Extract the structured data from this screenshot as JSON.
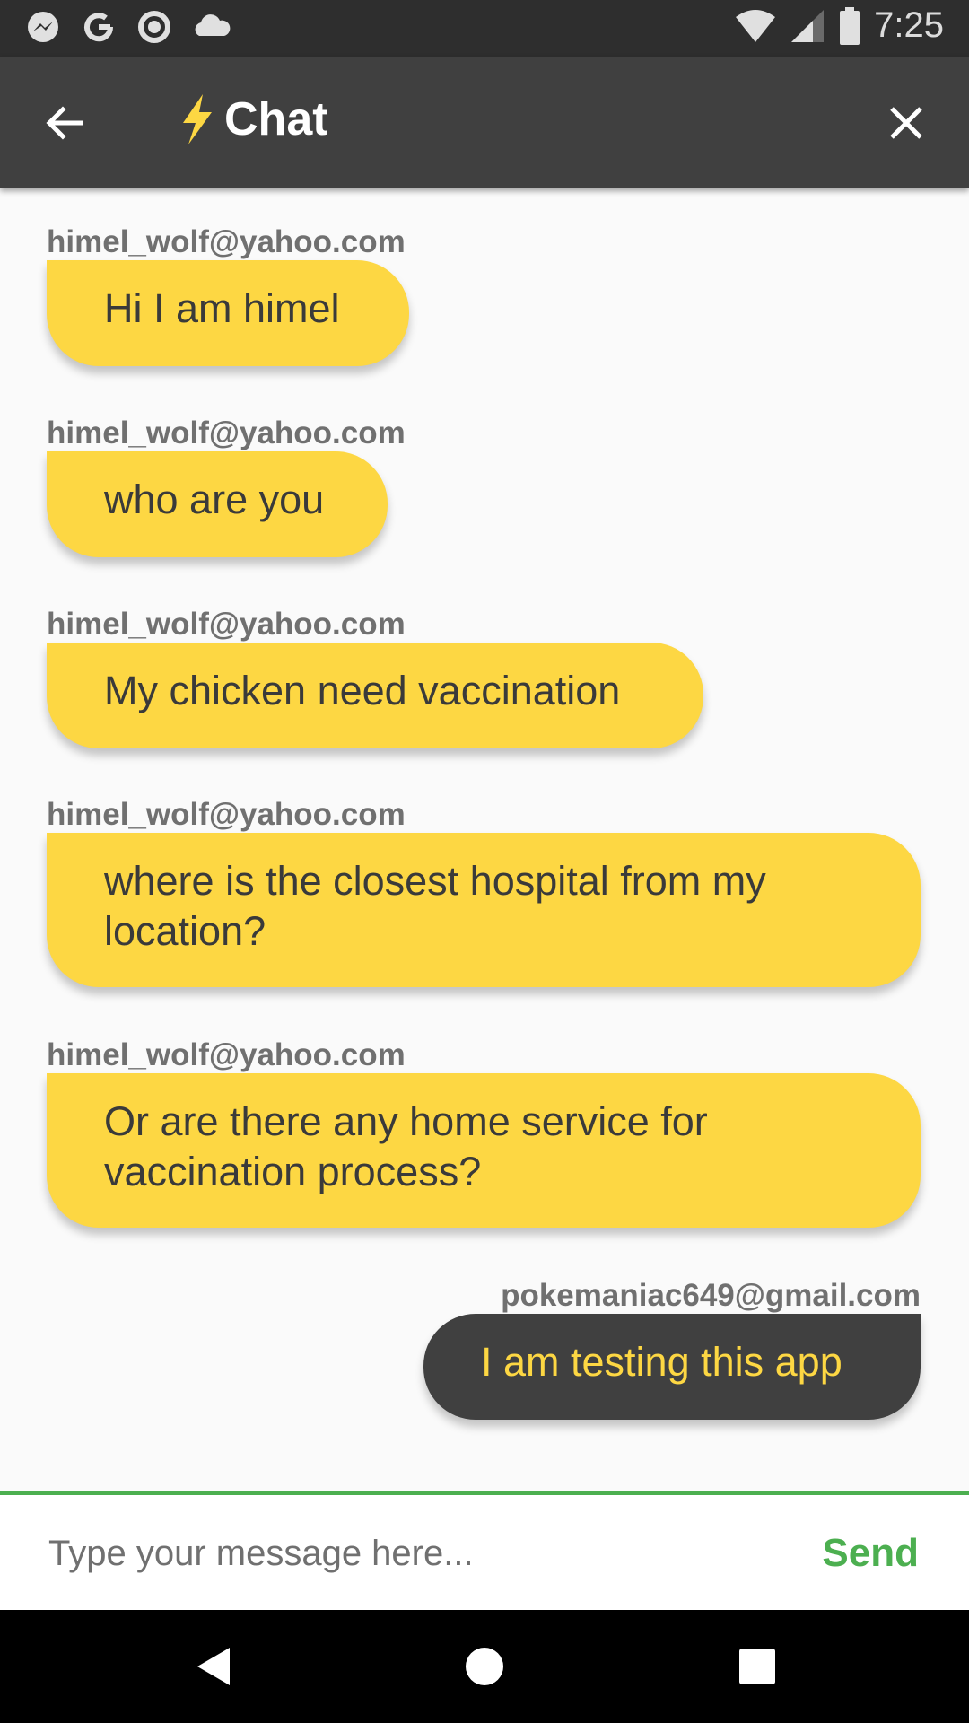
{
  "status_bar": {
    "time": "7:25",
    "left_icons": [
      "messenger-icon",
      "google-icon",
      "circle-icon",
      "cloud-icon"
    ],
    "right_icons": [
      "wifi-icon",
      "signal-icon",
      "battery-icon"
    ]
  },
  "app_bar": {
    "title": "Chat",
    "title_icon": "lightning-bolt-icon",
    "back_icon": "arrow-left-icon",
    "close_icon": "close-icon"
  },
  "messages": [
    {
      "direction": "incoming",
      "sender": "himel_wolf@yahoo.com",
      "text": "Hi I am himel"
    },
    {
      "direction": "incoming",
      "sender": "himel_wolf@yahoo.com",
      "text": "who are you"
    },
    {
      "direction": "incoming",
      "sender": "himel_wolf@yahoo.com",
      "text": "My chicken need vaccination"
    },
    {
      "direction": "incoming",
      "sender": "himel_wolf@yahoo.com",
      "text": "where is the closest hospital from my location?"
    },
    {
      "direction": "incoming",
      "sender": "himel_wolf@yahoo.com",
      "text": "Or are there any home service for vaccination process?"
    },
    {
      "direction": "outgoing",
      "sender": "pokemaniac649@gmail.com",
      "text": "I am testing this app"
    }
  ],
  "composer": {
    "placeholder": "Type your message here...",
    "value": "",
    "send_label": "Send"
  },
  "colors": {
    "incoming_bubble": "#fdd743",
    "outgoing_bubble": "#404040",
    "app_bar": "#404040",
    "accent": "#4caf50"
  }
}
